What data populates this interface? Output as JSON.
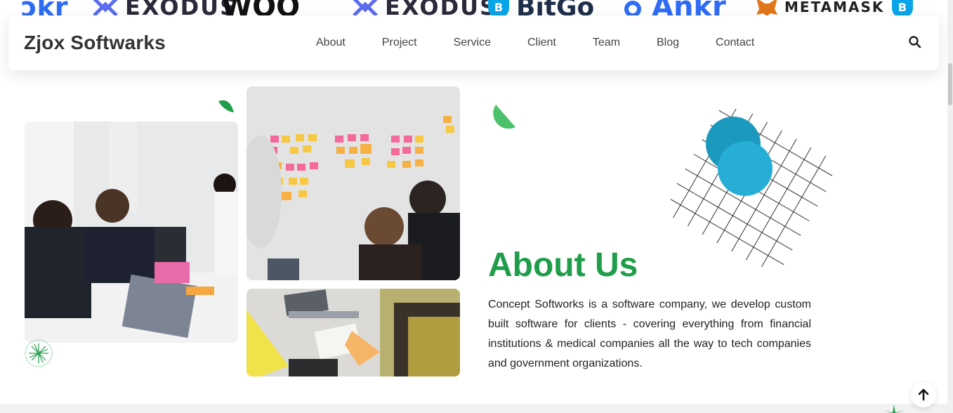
{
  "partners": [
    {
      "name": "ankr-partial",
      "text": "ɔkr",
      "color": "#2e6cf6"
    },
    {
      "name": "exodus",
      "text": "EXODUS",
      "color": "#5b6cf0"
    },
    {
      "name": "woo",
      "text": "WOO",
      "color": "#111111"
    },
    {
      "name": "exodus-2",
      "text": "EXODUS",
      "color": "#5b6cf0"
    },
    {
      "name": "bitgo",
      "text": "BitGo",
      "color": "#1f2f4a"
    },
    {
      "name": "ankr",
      "text": "Ankr",
      "color": "#2e6cf6"
    },
    {
      "name": "metamask",
      "text": "METAMASK",
      "color": "#222222"
    }
  ],
  "navbar": {
    "brand": "Zjox Softwarks",
    "items": [
      "About",
      "Project",
      "Service",
      "Client",
      "Team",
      "Blog",
      "Contact"
    ],
    "search_icon": "search-icon"
  },
  "about": {
    "title": "About Us",
    "text": "Concept Softworks is a software company, we develop custom built software for clients - covering everything from financial institutions & medical companies all the way to tech companies and government organizations."
  },
  "colors": {
    "accent_green": "#1f9d4a",
    "leaf_green": "#4cc16c",
    "circle_blue_dark": "#1c99bf",
    "circle_blue_light": "#27aed6"
  },
  "scroll_top_icon": "arrow-up-icon"
}
